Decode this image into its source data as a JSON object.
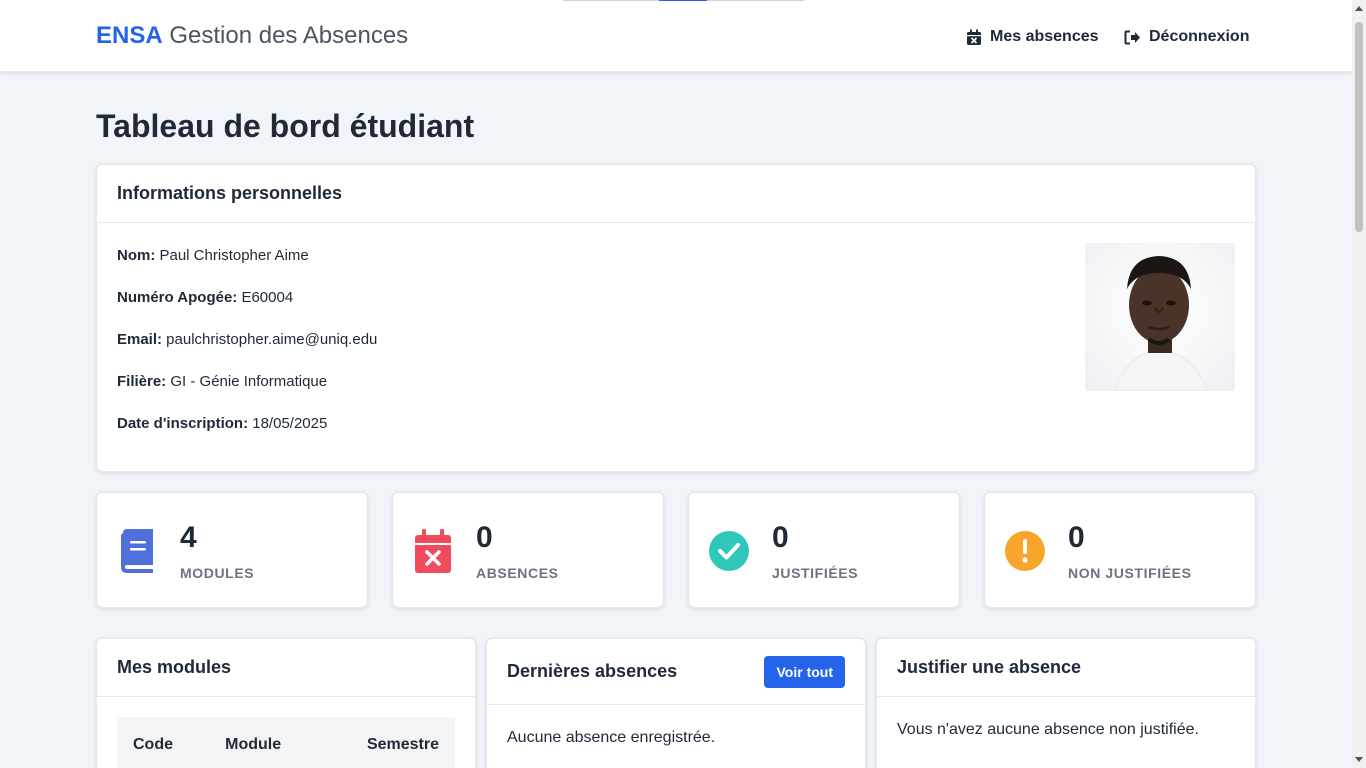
{
  "brand": {
    "accent": "ENSA",
    "rest": " Gestion des Absences"
  },
  "nav": {
    "absences": "Mes absences",
    "logout": "Déconnexion"
  },
  "page_title": "Tableau de bord étudiant",
  "info": {
    "header": "Informations personnelles",
    "rows": [
      {
        "label": "Nom:",
        "value": " Paul Christopher Aime"
      },
      {
        "label": "Numéro Apogée:",
        "value": " E60004"
      },
      {
        "label": "Email:",
        "value": " paulchristopher.aime@uniq.edu"
      },
      {
        "label": "Filière:",
        "value": " GI - Génie Informatique"
      },
      {
        "label": "Date d'inscription:",
        "value": " 18/05/2025"
      }
    ]
  },
  "stats": [
    {
      "number": "4",
      "label": "MODULES",
      "icon": "book-icon",
      "color": "#4f6fdc"
    },
    {
      "number": "0",
      "label": "ABSENCES",
      "icon": "calendar-x-icon",
      "color": "#f04b5c"
    },
    {
      "number": "0",
      "label": "JUSTIFIÉES",
      "icon": "check-circle-icon",
      "color": "#2ec7b9"
    },
    {
      "number": "0",
      "label": "NON JUSTIFIÉES",
      "icon": "exclamation-circle-icon",
      "color": "#f8a62b"
    }
  ],
  "modules": {
    "header": "Mes modules",
    "columns": [
      "Code",
      "Module",
      "Semestre"
    ]
  },
  "recent": {
    "header": "Dernières absences",
    "button": "Voir tout",
    "empty": "Aucune absence enregistrée."
  },
  "justify": {
    "header": "Justifier une absence",
    "empty": "Vous n'avez aucune absence non justifiée."
  },
  "colors": {
    "primary": "#2563eb",
    "background": "#f1f5f9"
  }
}
